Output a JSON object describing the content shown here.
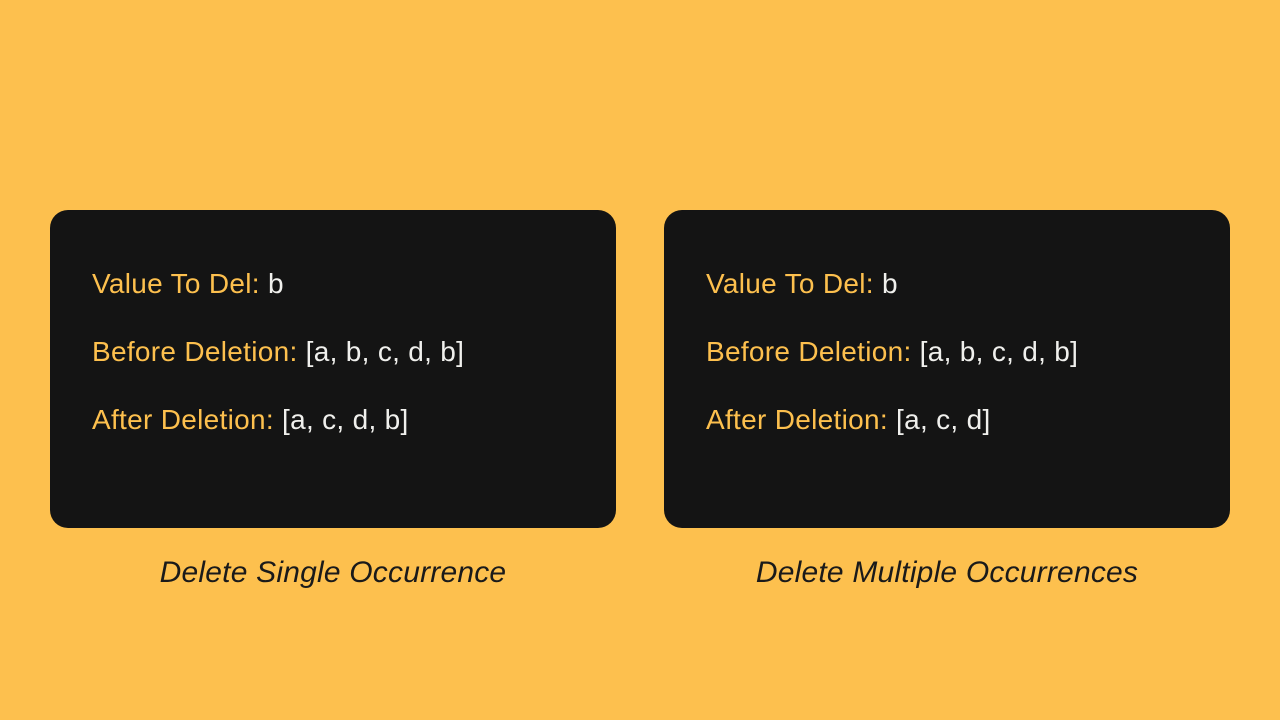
{
  "left": {
    "valueToDelLabel": "Value To Del: ",
    "valueToDel": "b",
    "beforeLabel": "Before Deletion: ",
    "beforeValue": "[a, b, c, d, b]",
    "afterLabel": "After Deletion: ",
    "afterValue": "[a, c, d, b]",
    "caption": "Delete Single Occurrence"
  },
  "right": {
    "valueToDelLabel": "Value To Del: ",
    "valueToDel": "b",
    "beforeLabel": "Before Deletion: ",
    "beforeValue": "[a, b, c, d, b]",
    "afterLabel": "After Deletion: ",
    "afterValue": "[a, c, d]",
    "caption": "Delete Multiple Occurrences"
  }
}
